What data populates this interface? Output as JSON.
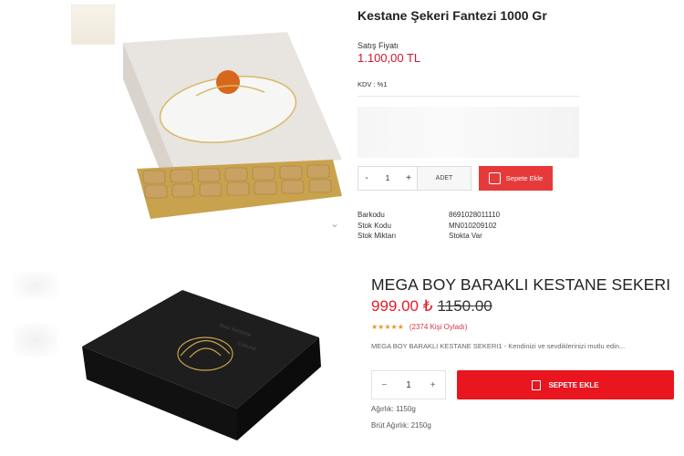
{
  "product1": {
    "title_prefix": "Kestane ",
    "title": "Kestane Şekeri Fantezi 1000 Gr",
    "price_label": "Satış Fiyatı",
    "price": "1.100,00 TL",
    "kdv": "KDV : %1",
    "qty": "1",
    "qty_minus": "-",
    "qty_plus": "+",
    "unit": "ADET",
    "cart_label": "Sepete Ekle",
    "specs": [
      {
        "key": "Barkodu",
        "value": "8691028011110"
      },
      {
        "key": "Stok Kodu",
        "value": "MN010209102"
      },
      {
        "key": "Stok Miktarı",
        "value": "Stokta Var"
      }
    ]
  },
  "product2": {
    "title": "MEGA BOY BARAKLI KESTANE SEKERI",
    "price": "999.00 ₺",
    "old_price": "1150.00",
    "stars": "★★★★★",
    "rating_count": "(2374 Kişi Oyladı)",
    "description": "MEGA BOY BARAKLI KESTANE SEKERI1 - Kendinizi ve sevdiklerinizi mutlu edin...",
    "qty": "1",
    "qty_minus": "−",
    "qty_plus": "+",
    "cart_label": "SEPETE EKLE",
    "weight": "Ağırlık: 1150g",
    "gross_weight": "Brüt Ağırlık: 2150g"
  },
  "colors": {
    "accent_red": "#e31d27",
    "price_red": "#d0182f",
    "star": "#e39a2a"
  },
  "icons": [
    "chevron-down-icon",
    "shopping-bag-icon"
  ]
}
